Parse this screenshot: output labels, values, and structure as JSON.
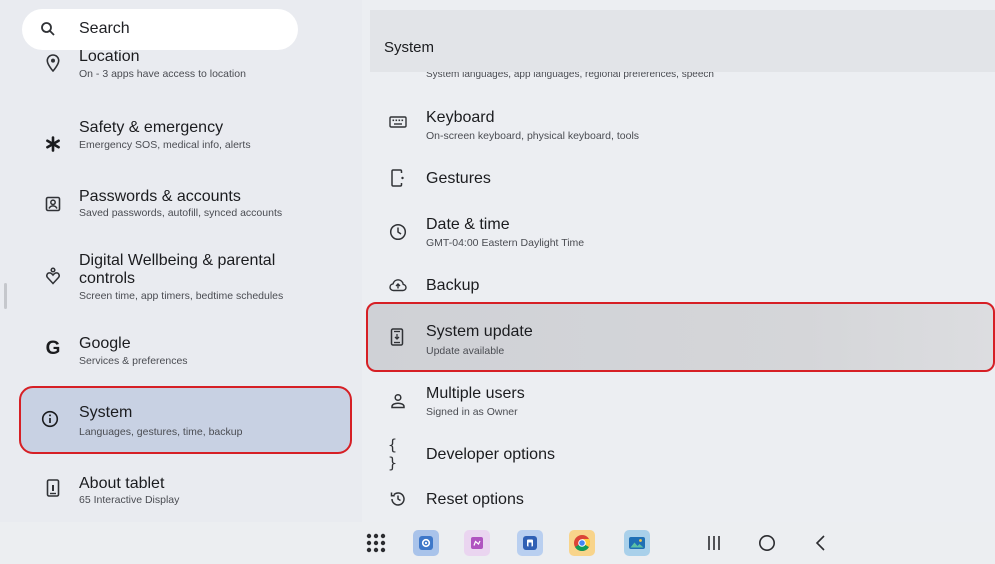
{
  "search": {
    "label": "Search"
  },
  "left_items": [
    {
      "title": "Location",
      "subtitle": "On - 3 apps have access to location",
      "icon": "location-icon"
    },
    {
      "title": "Safety & emergency",
      "subtitle": "Emergency SOS, medical info, alerts",
      "icon": "asterisk-icon"
    },
    {
      "title": "Passwords & accounts",
      "subtitle": "Saved passwords, autofill, synced accounts",
      "icon": "account-box-icon"
    },
    {
      "title_line1": "Digital Wellbeing & parental",
      "title_line2": "controls",
      "subtitle": "Screen time, app timers, bedtime schedules",
      "icon": "wellbeing-icon"
    },
    {
      "title": "Google",
      "subtitle": "Services & preferences",
      "icon": "google-icon"
    },
    {
      "title": "System",
      "subtitle": "Languages, gestures, time, backup",
      "icon": "info-icon"
    },
    {
      "title": "About tablet",
      "subtitle": "65 Interactive Display",
      "icon": "tablet-icon"
    }
  ],
  "right_header": {
    "title": "System"
  },
  "right_cutoff": "System languages, app languages, regional preferences, speech",
  "right_items": [
    {
      "title": "Keyboard",
      "subtitle": "On-screen keyboard, physical keyboard, tools",
      "icon": "keyboard-icon"
    },
    {
      "title": "Gestures",
      "icon": "gestures-icon"
    },
    {
      "title": "Date & time",
      "subtitle": "GMT-04:00 Eastern Daylight Time",
      "icon": "clock-icon"
    },
    {
      "title": "Backup",
      "icon": "cloud-upload-icon"
    },
    {
      "title": "System update",
      "subtitle": "Update available",
      "icon": "system-update-icon"
    },
    {
      "title": "Multiple users",
      "subtitle": "Signed in as Owner",
      "icon": "person-icon"
    },
    {
      "title": "Developer options",
      "icon": "braces-icon",
      "glyph": "{ }"
    },
    {
      "title": "Reset options",
      "icon": "history-icon"
    }
  ],
  "nav": {
    "apps": [
      "app-grid-icon",
      "settings-app-icon",
      "notes-app-icon",
      "files-app-icon",
      "chrome-app-icon",
      "gallery-app-icon"
    ],
    "buttons": [
      "recents-button",
      "home-button",
      "back-button"
    ]
  },
  "colors": {
    "highlight_border": "#d61f25",
    "selected_bg": "#c8d1e3"
  }
}
